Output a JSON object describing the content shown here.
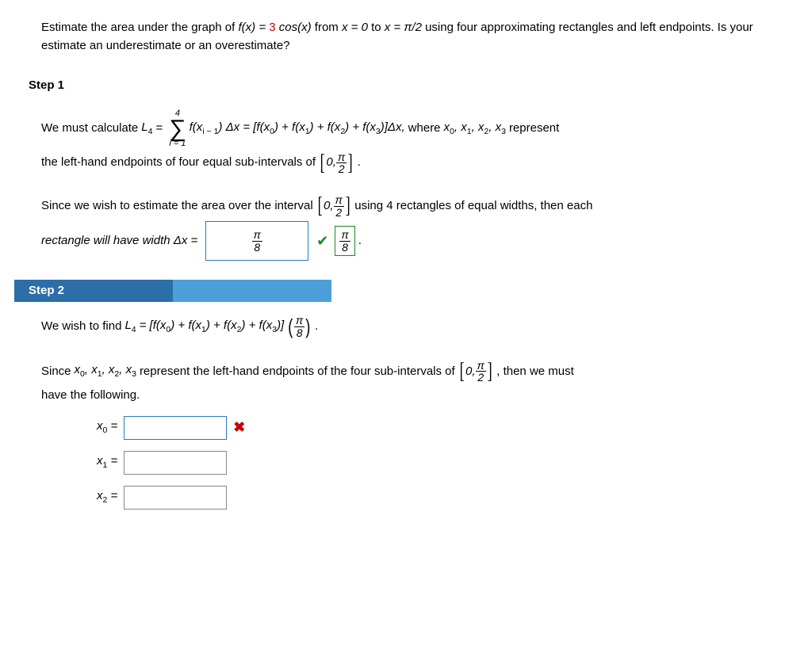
{
  "question": {
    "pre": "Estimate the area under the graph of ",
    "fx": "f(x) = ",
    "coef": "3",
    "cos": " cos(x)",
    "from": " from ",
    "x0": "x = 0",
    "to": " to ",
    "x1": "x = π/2",
    "rest": " using four approximating rectangles and left endpoints. Is your estimate an underestimate or an overestimate?"
  },
  "step1": {
    "label": "Step 1",
    "t1": "We must calculate  ",
    "L4": "L",
    "L4sub": "4",
    "eq": " = ",
    "sigma_top": "4",
    "sigma_bot": "i = 1",
    "sum_expr": "f(x",
    "sum_sub": "i − 1",
    "sum_rest": ") Δx = [f(x",
    "x0s": "0",
    "plus1": ") + f(x",
    "x1s": "1",
    "plus2": ") + f(x",
    "x2s": "2",
    "plus3": ") + f(x",
    "x3s": "3",
    "close": ")]Δx,",
    "where": "  where  ",
    "x_list": "x",
    "rep": "  represent",
    "line2": "the left-hand endpoints of four equal sub-intervals of  ",
    "zero": "0, ",
    "pi": "π",
    "two": "2",
    "period": ".",
    "since_a": "Since we wish to estimate the area over the interval  ",
    "since_b": "  using 4 rectangles of equal widths, then each",
    "rect_line": "rectangle will have width  Δx = ",
    "ans_num": "π",
    "ans_den": "8",
    "conf_num": "π",
    "conf_den": "8"
  },
  "step2": {
    "label": "Step 2",
    "t1": "We wish to find  ",
    "L4": "L",
    "L4sub": "4",
    "eq": " = [f(x",
    "x0s": "0",
    "p1": ") + f(x",
    "x1s": "1",
    "p2": ") + f(x",
    "x2s": "2",
    "p3": ") + f(x",
    "x3s": "3",
    "close": ")]",
    "pi": "π",
    "eight": "8",
    "period": " .",
    "since_a": "Since  ",
    "x_list": "x",
    "rep": "  represent the left-hand endpoints of the four sub-intervals of  ",
    "zero": "0, ",
    "two": "2",
    "then": ",  then we must",
    "have": "have the following.",
    "rows": [
      {
        "lhs_sub": "0",
        "active": true,
        "wrong": true
      },
      {
        "lhs_sub": "1",
        "active": false,
        "wrong": false
      },
      {
        "lhs_sub": "2",
        "active": false,
        "wrong": false
      }
    ]
  }
}
